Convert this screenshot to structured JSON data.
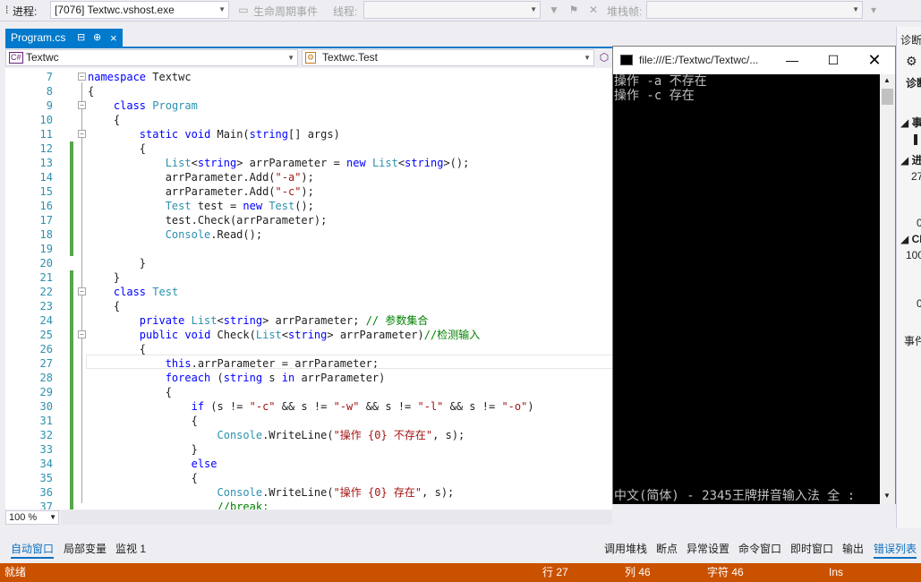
{
  "debug_toolbar": {
    "process_label": "进程:",
    "process_value": "[7076] Textwc.vshost.exe",
    "lifecycle_label": "生命周期事件",
    "thread_label": "线程:",
    "stackframe_label": "堆栈帧:"
  },
  "tabs": [
    {
      "label": "Program.cs",
      "pin": "⊕",
      "close": "×"
    }
  ],
  "navbar": {
    "project": "Textwc",
    "type": "Textwc.Test",
    "project_badge": "C#"
  },
  "editor": {
    "lines": [
      {
        "n": "7",
        "t": "namespace Textwc"
      },
      {
        "n": "8",
        "t": "{"
      },
      {
        "n": "9",
        "t": "    class Program"
      },
      {
        "n": "10",
        "t": "    {"
      },
      {
        "n": "11",
        "t": "        static void Main(string[] args)"
      },
      {
        "n": "12",
        "t": "        {"
      },
      {
        "n": "13",
        "t": "            List<string> arrParameter = new List<string>();"
      },
      {
        "n": "14",
        "t": "            arrParameter.Add(\"-a\");"
      },
      {
        "n": "15",
        "t": "            arrParameter.Add(\"-c\");"
      },
      {
        "n": "16",
        "t": "            Test test = new Test();"
      },
      {
        "n": "17",
        "t": "            test.Check(arrParameter);"
      },
      {
        "n": "18",
        "t": "            Console.Read();"
      },
      {
        "n": "19",
        "t": ""
      },
      {
        "n": "20",
        "t": "        }"
      },
      {
        "n": "21",
        "t": "    }"
      },
      {
        "n": "22",
        "t": "    class Test"
      },
      {
        "n": "23",
        "t": "    {"
      },
      {
        "n": "24",
        "t": "        private List<string> arrParameter; // 参数集合"
      },
      {
        "n": "25",
        "t": "        public void Check(List<string> arrParameter)//检测输入"
      },
      {
        "n": "26",
        "t": "        {"
      },
      {
        "n": "27",
        "t": "            this.arrParameter = arrParameter;"
      },
      {
        "n": "28",
        "t": "            foreach (string s in arrParameter)"
      },
      {
        "n": "29",
        "t": "            {"
      },
      {
        "n": "30",
        "t": "                if (s != \"-c\" && s != \"-w\" && s != \"-l\" && s != \"-o\")"
      },
      {
        "n": "31",
        "t": "                {"
      },
      {
        "n": "32",
        "t": "                    Console.WriteLine(\"操作 {0} 不存在\", s);"
      },
      {
        "n": "33",
        "t": "                }"
      },
      {
        "n": "34",
        "t": "                else"
      },
      {
        "n": "35",
        "t": "                {"
      },
      {
        "n": "36",
        "t": "                    Console.WriteLine(\"操作 {0} 存在\", s);"
      },
      {
        "n": "37",
        "t": "                    //break;"
      }
    ]
  },
  "zoom": "100 %",
  "console": {
    "title": "file:///E:/Textwc/Textwc/...",
    "output": [
      "操作 -a 不存在",
      "操作 -c 存在"
    ],
    "ime_line": "中文(简体) - 2345王牌拼音输入法 全 :"
  },
  "diag_pane": {
    "title": "诊断",
    "items": [
      "诊断",
      "事",
      "进",
      "27",
      "0",
      "CP",
      "100",
      "0",
      "事件"
    ]
  },
  "bottom_tabs_left": [
    "自动窗口",
    "局部变量",
    "监视 1"
  ],
  "bottom_tabs_right": [
    "调用堆栈",
    "断点",
    "异常设置",
    "命令窗口",
    "即时窗口",
    "输出",
    "错误列表"
  ],
  "status": {
    "ready": "就绪",
    "row": "行 27",
    "col": "列 46",
    "char": "字符 46",
    "mode": "Ins"
  },
  "colors": {
    "accent": "#007acc",
    "status_bar": "#ca5100",
    "change_bar": "#57a64a"
  }
}
